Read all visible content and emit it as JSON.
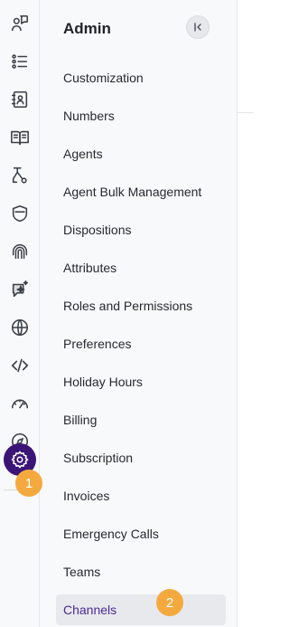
{
  "panel": {
    "title": "Admin",
    "collapse_icon": "collapse-left-icon"
  },
  "rail": {
    "icons": [
      "conversation-person-icon",
      "list-icon",
      "contacts-book-icon",
      "open-book-icon",
      "flow-icon",
      "shield-icon",
      "fingerprint-icon",
      "ai-sparkle-icon",
      "globe-icon",
      "code-icon",
      "speedometer-icon",
      "compass-icon",
      "gear-icon"
    ],
    "active_icon": "gear-icon",
    "active_color": "#3b1478"
  },
  "menu": {
    "items": [
      "Customization",
      "Numbers",
      "Agents",
      "Agent Bulk Management",
      "Dispositions",
      "Attributes",
      "Roles and Permissions",
      "Preferences",
      "Holiday Hours",
      "Billing",
      "Subscription",
      "Invoices",
      "Emergency Calls",
      "Teams",
      "Channels"
    ],
    "selected": "Channels"
  },
  "annotations": {
    "step1": "1",
    "step2": "2",
    "badge_color": "#f4a93f"
  }
}
